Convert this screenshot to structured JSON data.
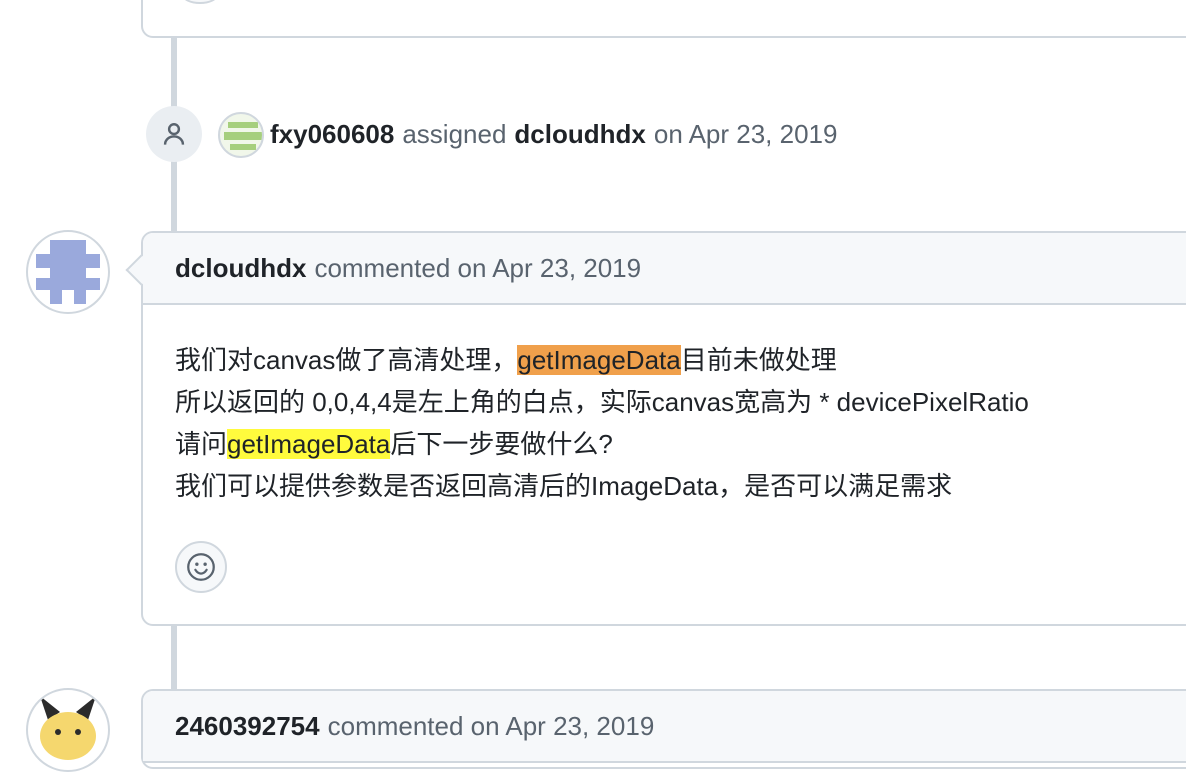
{
  "assign_event": {
    "actor": "fxy060608",
    "action": "assigned",
    "assignee": "dcloudhdx",
    "date": "on Apr 23, 2019"
  },
  "comment": {
    "author": "dcloudhdx",
    "meta": "commented on Apr 23, 2019",
    "lines": [
      {
        "before": "我们对canvas做了高清处理，",
        "highlight": "getImageData",
        "after": "目前未做处理"
      },
      {
        "text": "所以返回的 0,0,4,4是左上角的白点，实际canvas宽高为 * devicePixelRatio"
      },
      {
        "before": "请问",
        "highlight": "getImageData",
        "after": "后下一步要做什么?"
      },
      {
        "text": "我们可以提供参数是否返回高清后的ImageData，是否可以满足需求"
      }
    ],
    "highlight_colors": {
      "orange": "#f0a04b",
      "yellow": "#fffb3d"
    }
  },
  "next_comment": {
    "author": "2460392754",
    "meta": "commented on Apr 23, 2019"
  },
  "icons": {
    "event": "person-icon",
    "reaction": "smiley-icon"
  }
}
